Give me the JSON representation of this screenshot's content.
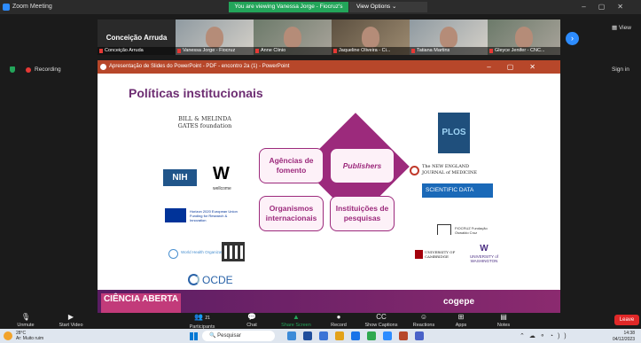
{
  "window": {
    "app_title": "Zoom Meeting",
    "viewing_banner": "You are viewing Vanessa Jorge - Fiocruz's screen",
    "view_options": "View Options"
  },
  "participants": {
    "active_speaker": "Conceição Arruda",
    "tiles": [
      {
        "name": "Conceição Arruda"
      },
      {
        "name": "Vanessa Jorge - Fiocruz"
      },
      {
        "name": "Anne Clinio"
      },
      {
        "name": "Jaqueline Oliveira - Ci..."
      },
      {
        "name": "Tatiana Martins"
      },
      {
        "name": "Gleyce Jenifer - CNC..."
      }
    ],
    "view_label": "View",
    "sign_in": "Sign in"
  },
  "recording": {
    "label": "Recording"
  },
  "ppt": {
    "title": "Apresentação de Slides do PowerPoint - PDF - encontro 2a (1) - PowerPoint"
  },
  "slide": {
    "title": "Políticas institucionais",
    "boxes": {
      "top_left": "Agências de fomento",
      "top_right": "Publishers",
      "bottom_left": "Organismos internacionais",
      "bottom_right": "Instituições de pesquisas"
    },
    "logos": {
      "gates": "BILL & MELINDA GATES foundation",
      "nih": "NIH",
      "wellcome": "W",
      "wellcome_sub": "wellcome",
      "eu": "Horizon 2020 European Union Funding for Research & Innovation",
      "who": "World Health Organization",
      "ocde": "OCDE",
      "plos": "PLOS",
      "nejm": "The NEW ENGLAND JOURNAL of MEDICINE",
      "scidata": "SCIENTIFIC DATA",
      "fiocruz": "FIOCRUZ Fundação Oswaldo Cruz",
      "cambridge": "UNIVERSITY OF CAMBRIDGE",
      "uw_letter": "W",
      "uw": "UNIVERSITY of WASHINGTON"
    },
    "footer": {
      "ciencia": "CIÊNCIA ABERTA",
      "cogepe": "cogepe"
    }
  },
  "toolbar": {
    "unmute": "Unmute",
    "start_video": "Start Video",
    "participants": "Participants",
    "participants_count": "21",
    "chat": "Chat",
    "share_screen": "Share Screen",
    "record": "Record",
    "show_captions": "Show Captions",
    "reactions": "Reactions",
    "apps": "Apps",
    "notes": "Notes",
    "leave": "Leave"
  },
  "taskbar": {
    "temp": "28°C",
    "weather_desc": "Ar: Muito ruim",
    "search": "Pesquisar",
    "time": "14:38",
    "date": "04/12/2023"
  },
  "colors": {
    "accent": "#9c2a7c",
    "title": "#6d2d72",
    "zoom_blue": "#2d8cff",
    "share_green": "#23a55a",
    "leave_red": "#e02828"
  }
}
